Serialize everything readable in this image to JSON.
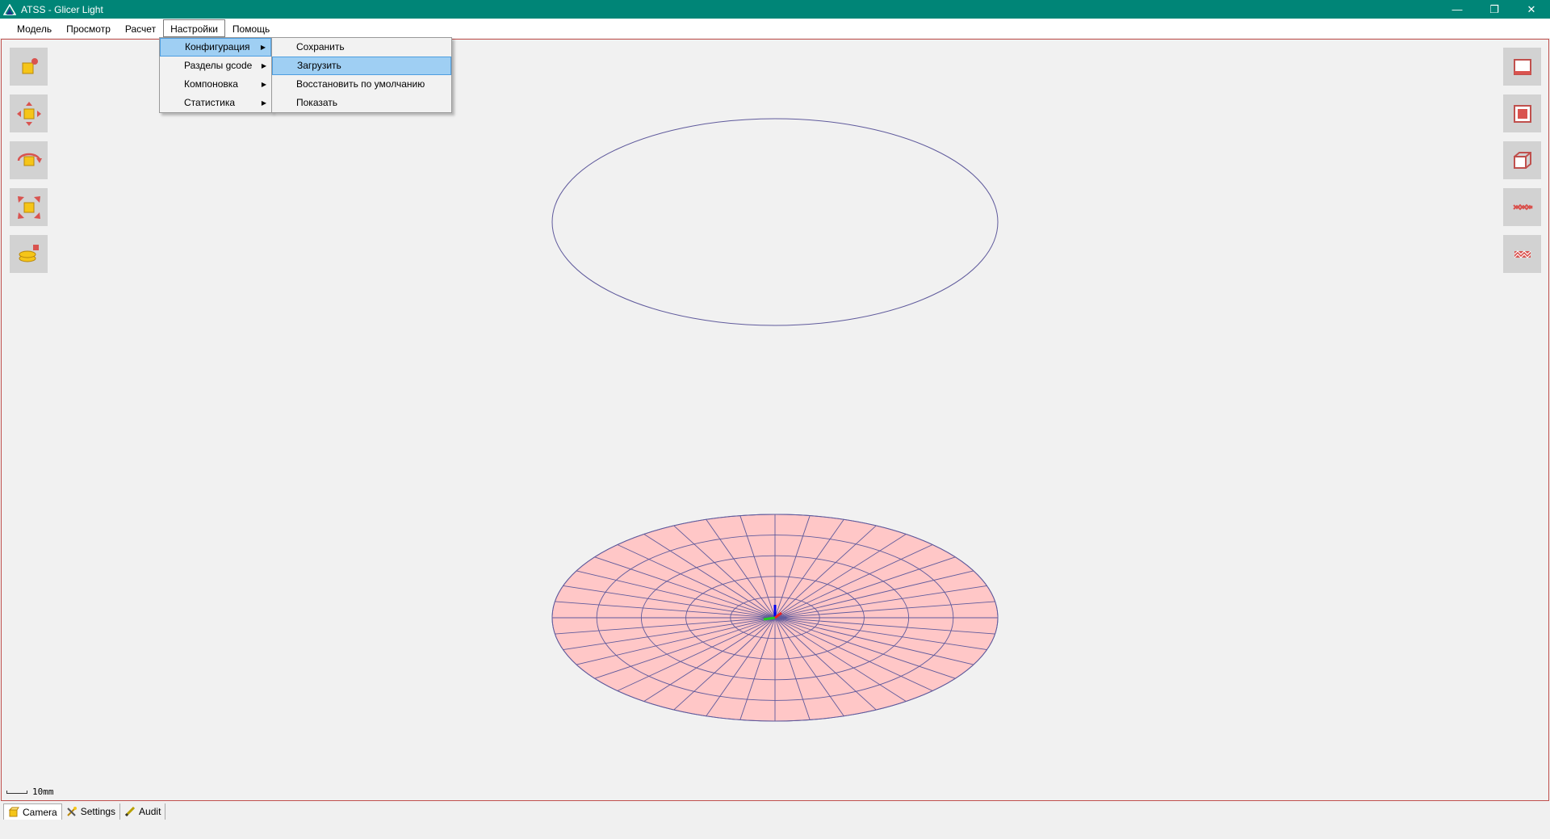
{
  "window": {
    "title": "ATSS - Glicer Light",
    "controls": {
      "minimize": "—",
      "restore": "❐",
      "close": "✕"
    }
  },
  "menubar": {
    "items": [
      "Модель",
      "Просмотр",
      "Расчет",
      "Настройки",
      "Помощь"
    ]
  },
  "settings_menu": {
    "items": [
      "Конфигурация",
      "Разделы gcode",
      "Компоновка",
      "Статистика"
    ]
  },
  "config_submenu": {
    "items": [
      "Сохранить",
      "Загрузить",
      "Восстановить по умолчанию",
      "Показать"
    ]
  },
  "left_toolbar": {
    "icons": [
      "select-icon",
      "move-icon",
      "rotate-icon",
      "scale-icon",
      "layers-icon"
    ]
  },
  "right_toolbar": {
    "icons": [
      "front-view-icon",
      "top-view-icon",
      "iso-view-icon",
      "pattern-1-icon",
      "pattern-2-icon"
    ]
  },
  "scale_bar": {
    "label": "10mm"
  },
  "tabs": {
    "items": [
      "Camera",
      "Settings",
      "Audit"
    ],
    "active": "Camera"
  },
  "colors": {
    "titlebar": "#008577",
    "accent_red": "#c0504d",
    "disc_fill": "#ffc7c7",
    "disc_lines": "#5f5a9c",
    "menu_highlight": "#9fcff3"
  }
}
